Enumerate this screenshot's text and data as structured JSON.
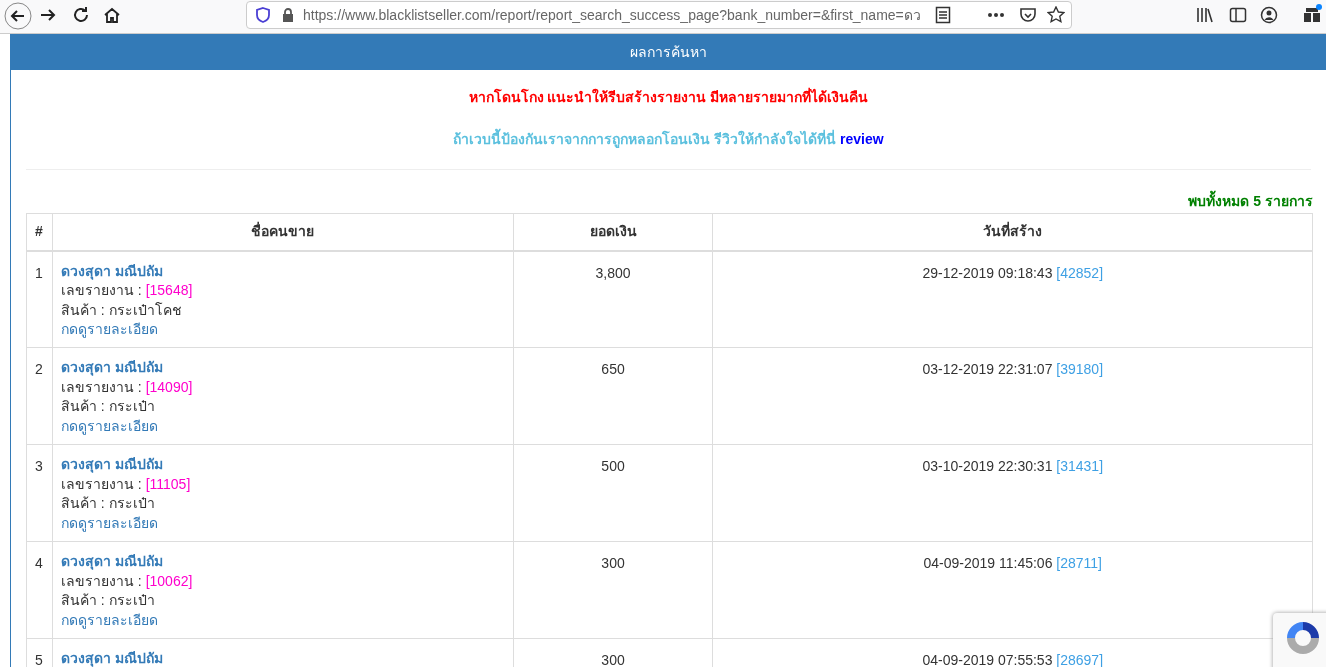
{
  "browser": {
    "url": "https://www.blacklistseller.com/report/report_search_success_page?bank_number=&first_name=ดว"
  },
  "panel": {
    "title": "ผลการค้นหา"
  },
  "warning": "หากโดนโกง แนะนำให้รีบสร้างรายงาน มีหลายรายมากที่ได้เงินคืน",
  "review_prompt": {
    "text": "ถ้าเวบนี้ป้องกันเราจากการถูกหลอกโอนเงิน รีวิวให้กำลังใจได้ที่นี่",
    "link": "review"
  },
  "result_count": "พบทั้งหมด **5** รายการ",
  "table": {
    "columns": [
      "#",
      "ชื่อคนขาย",
      "ยอดเงิน",
      "วันที่สร้าง"
    ],
    "rows": [
      {
        "index": "1",
        "seller": "ดวงสุดา มณีปถัม",
        "report_label": "เลขรายงาน :",
        "report_number": "[15648]",
        "product": "สินค้า : กระเป๋าโคช",
        "details_link": "กดดูรายละเอียด",
        "amount": "3,800",
        "created": "29-12-2019 09:18:43",
        "created_id": "[42852]"
      },
      {
        "index": "2",
        "seller": "ดวงสุดา มณีปถัม",
        "report_label": "เลขรายงาน :",
        "report_number": "[14090]",
        "product": "สินค้า : กระเป๋า",
        "details_link": "กดดูรายละเอียด",
        "amount": "650",
        "created": "03-12-2019 22:31:07",
        "created_id": "[39180]"
      },
      {
        "index": "3",
        "seller": "ดวงสุดา มณีปถัม",
        "report_label": "เลขรายงาน :",
        "report_number": "[11105]",
        "product": "สินค้า : กระเป๋า",
        "details_link": "กดดูรายละเอียด",
        "amount": "500",
        "created": "03-10-2019 22:30:31",
        "created_id": "[31431]"
      },
      {
        "index": "4",
        "seller": "ดวงสุดา มณีปถัม",
        "report_label": "เลขรายงาน :",
        "report_number": "[10062]",
        "product": "สินค้า : กระเป๋า",
        "details_link": "กดดูรายละเอียด",
        "amount": "300",
        "created": "04-09-2019 11:45:06",
        "created_id": "[28711]"
      },
      {
        "index": "5",
        "seller": "ดวงสุดา มณีปถัม",
        "amount": "300",
        "created": "04-09-2019 07:55:53",
        "created_id": "[28697]"
      }
    ]
  }
}
